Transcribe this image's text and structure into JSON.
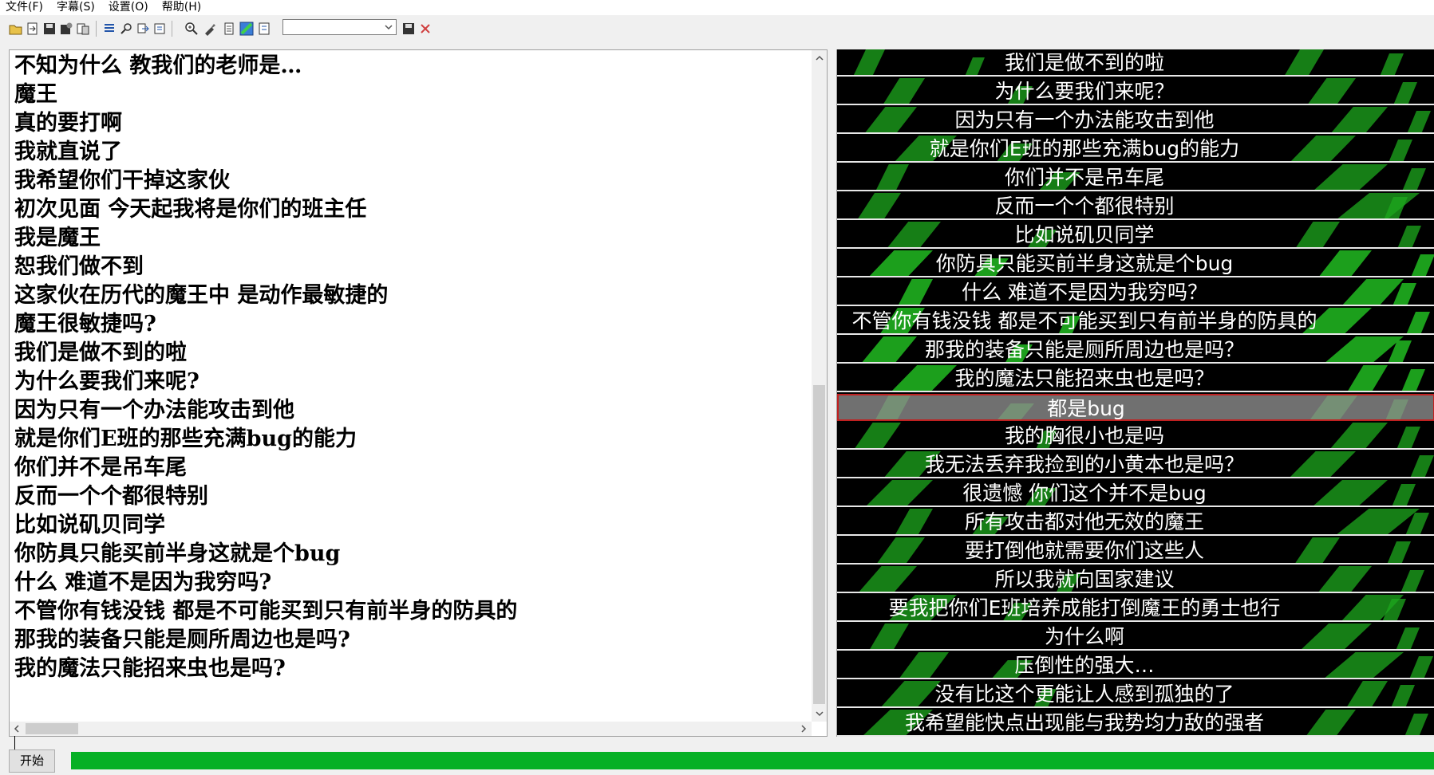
{
  "menubar": {
    "items": [
      "文件(F)",
      "字幕(S)",
      "设置(O)",
      "帮助(H)"
    ]
  },
  "toolbar": {
    "font_combo_value": "",
    "icons": [
      "open-file-icon",
      "import-icon",
      "save-icon",
      "save-as-icon",
      "export-icon",
      "list-icon",
      "search-icon",
      "copy-icon",
      "paste-icon",
      "zoom-icon",
      "brush-icon",
      "page-icon",
      "color-icon",
      "format-icon",
      "font-save-icon",
      "delete-icon"
    ]
  },
  "editor": {
    "lines": [
      "不知为什么  教我们的老师是…",
      "魔王",
      "真的要打啊",
      "我就直说了",
      "我希望你们干掉这家伙",
      "初次见面  今天起我将是你们的班主任",
      "我是魔王",
      "恕我们做不到",
      "这家伙在历代的魔王中  是动作最敏捷的",
      "魔王很敏捷吗?",
      "我们是做不到的啦",
      "为什么要我们来呢?",
      "因为只有一个办法能攻击到他",
      "就是你们E班的那些充满bug的能力",
      "你们并不是吊车尾",
      "反而一个个都很特别",
      "比如说矶贝同学",
      "你防具只能买前半身这就是个bug",
      "什么  难道不是因为我穷吗?",
      "不管你有钱没钱  都是不可能买到只有前半身的防具的",
      "那我的装备只能是厕所周边也是吗?",
      "我的魔法只能招来虫也是吗?"
    ]
  },
  "subtitles": {
    "selected_index": 12,
    "rows": [
      "我们是做不到的啦",
      "为什么要我们来呢？",
      "因为只有一个办法能攻击到他",
      "就是你们E班的那些充满bug的能力",
      "你们并不是吊车尾",
      "反而一个个都很特别",
      "比如说矶贝同学",
      "你防具只能买前半身这就是个bug",
      "什么  难道不是因为我穷吗？",
      "不管你有钱没钱  都是不可能买到只有前半身的防具的",
      "那我的装备只能是厕所周边也是吗？",
      "我的魔法只能招来虫也是吗？",
      "都是bug",
      "我的胸很小也是吗",
      "我无法丢弃我捡到的小黄本也是吗？",
      "很遗憾  你们这个并不是bug",
      "所有攻击都对他无效的魔王",
      "要打倒他就需要你们这些人",
      "所以我就向国家建议",
      "要我把你们E班培养成能打倒魔王的勇士也行",
      "为什么啊",
      "压倒性的强大…",
      "没有比这个更能让人感到孤独的了",
      "我希望能快点出现能与我势均力敌的强者"
    ]
  },
  "bottom": {
    "start_label": "开始",
    "progress": 1.0
  },
  "colors": {
    "progress_fill": "#06b025",
    "subtitle_bg": "#000000",
    "subtitle_accent": "#1ea81e",
    "selection_border": "#c02020"
  }
}
